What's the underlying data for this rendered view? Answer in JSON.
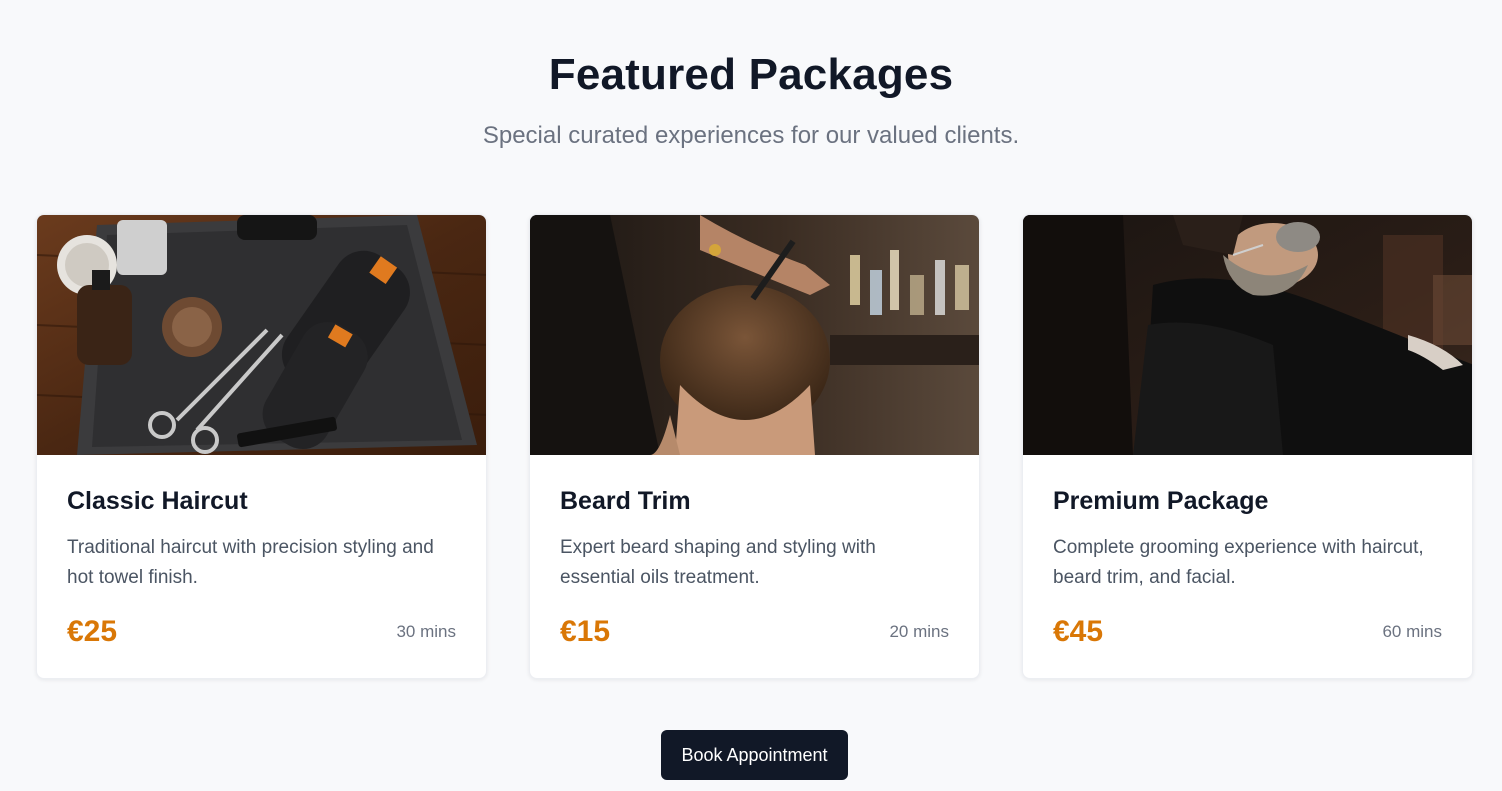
{
  "header": {
    "title": "Featured Packages",
    "subtitle": "Special curated experiences for our valued clients."
  },
  "packages": [
    {
      "title": "Classic Haircut",
      "description": "Traditional haircut with precision styling and hot towel finish.",
      "price": "€25",
      "duration": "30 mins",
      "image": "barber-tools-photo"
    },
    {
      "title": "Beard Trim",
      "description": "Expert beard shaping and styling with essential oils treatment.",
      "price": "€15",
      "duration": "20 mins",
      "image": "haircut-in-progress-photo"
    },
    {
      "title": "Premium Package",
      "description": "Complete grooming experience with haircut, beard trim, and facial.",
      "price": "€45",
      "duration": "60 mins",
      "image": "beard-grooming-photo"
    }
  ],
  "cta": {
    "label": "Book Appointment"
  },
  "colors": {
    "accent": "#d97706",
    "dark": "#111827",
    "muted": "#6b7280",
    "background": "#f8f9fb"
  }
}
